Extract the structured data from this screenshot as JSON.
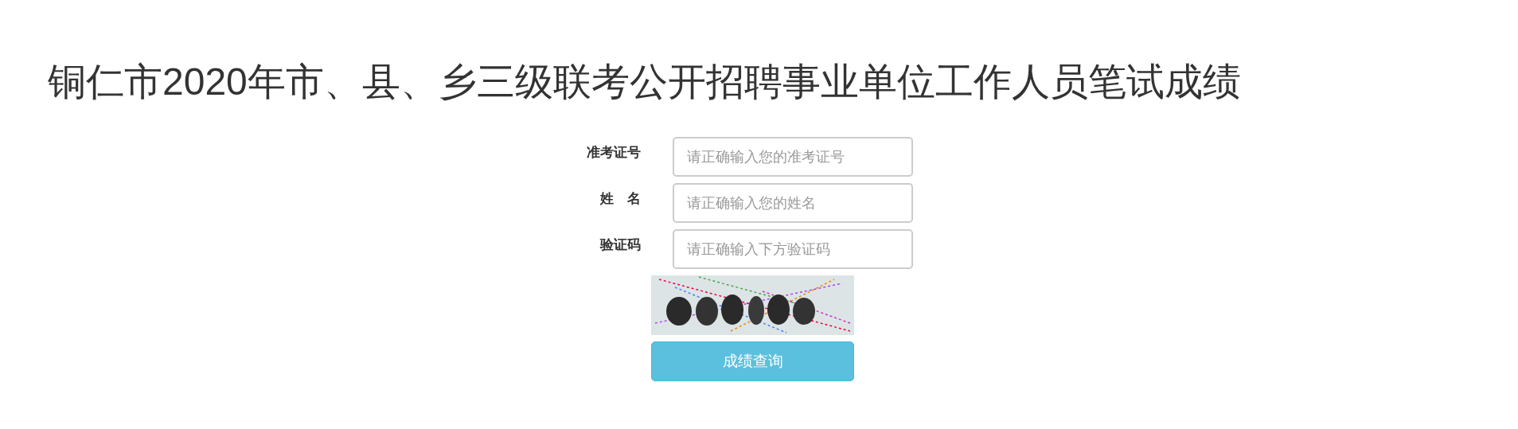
{
  "title": "铜仁市2020年市、县、乡三级联考公开招聘事业单位工作人员笔试成绩",
  "form": {
    "fields": [
      {
        "label": "准考证号",
        "placeholder": "请正确输入您的准考证号"
      },
      {
        "label": "姓　名",
        "placeholder": "请正确输入您的姓名"
      },
      {
        "label": "验证码",
        "placeholder": "请正确输入下方验证码"
      }
    ],
    "submit": "成绩查询"
  }
}
